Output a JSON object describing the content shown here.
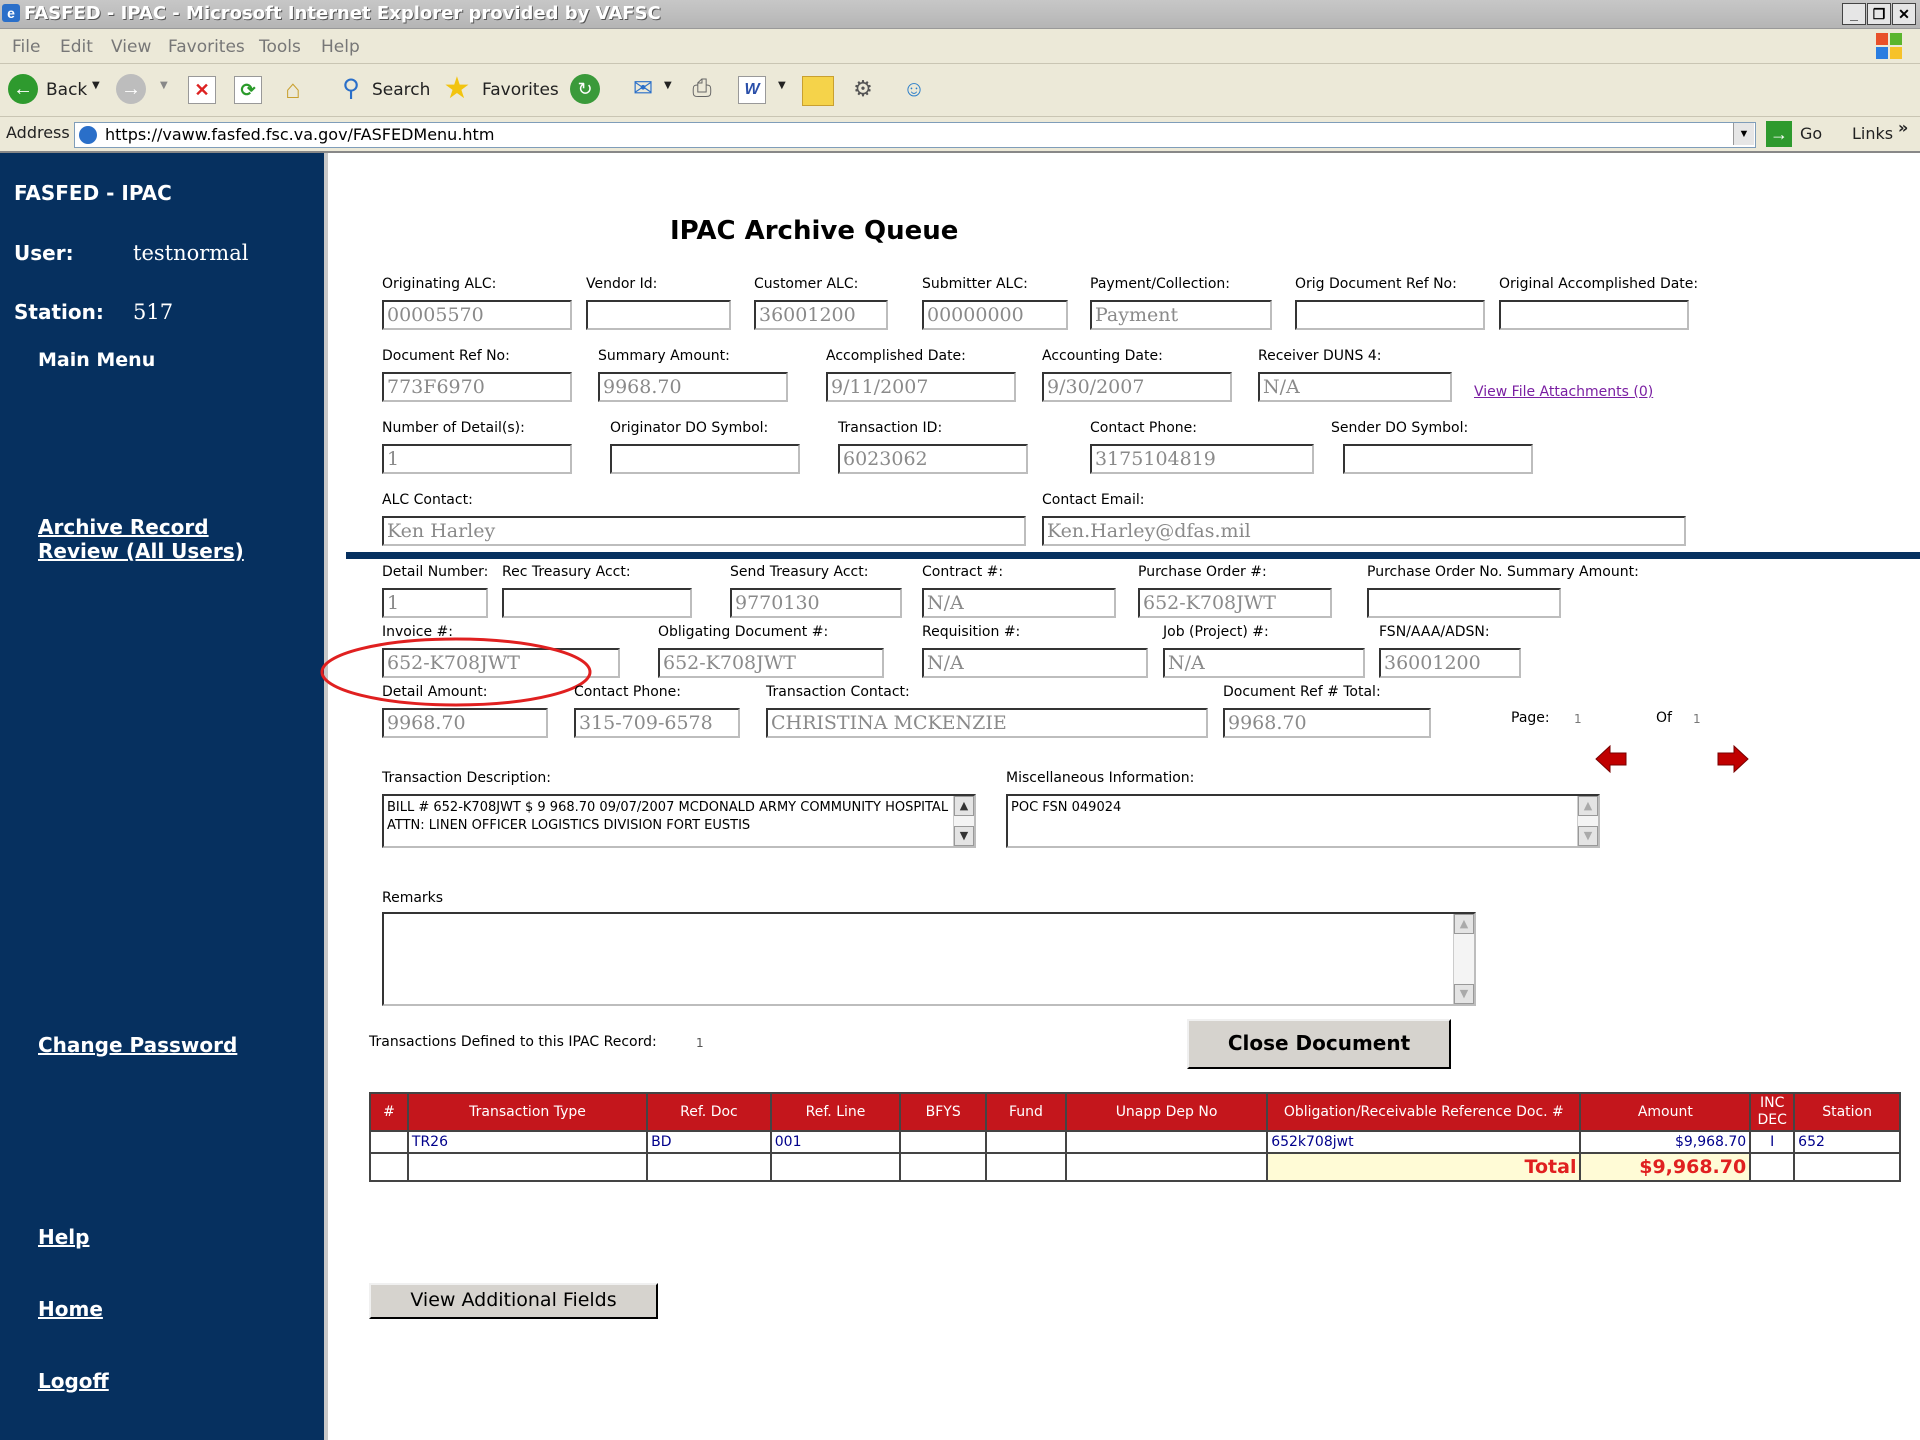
{
  "window": {
    "title": "FASFED - IPAC - Microsoft Internet Explorer provided by VAFSC",
    "ie_glyph": "e"
  },
  "menu": [
    "File",
    "Edit",
    "View",
    "Favorites",
    "Tools",
    "Help"
  ],
  "toolbar": {
    "back": "Back",
    "search": "Search",
    "favorites": "Favorites"
  },
  "address": {
    "label": "Address",
    "url": "https://vaww.fasfed.fsc.va.gov/FASFEDMenu.htm",
    "go": "Go",
    "links": "Links"
  },
  "sidebar": {
    "app_title": "FASFED - IPAC",
    "user_label": "User:",
    "user_value": "testnormal",
    "station_label": "Station:",
    "station_value": "517",
    "main_menu": "Main Menu",
    "archive_link_1": "Archive Record",
    "archive_link_2": "Review (All Users)",
    "change_password": "Change Password",
    "help": "Help",
    "home": "Home",
    "logoff": "Logoff"
  },
  "page": {
    "title": "IPAC Archive Queue",
    "fields": {
      "orig_alc": {
        "label": "Originating ALC:",
        "value": "00005570"
      },
      "vendor_id": {
        "label": "Vendor Id:",
        "value": ""
      },
      "customer_alc": {
        "label": "Customer ALC:",
        "value": "36001200"
      },
      "submitter_alc": {
        "label": "Submitter ALC:",
        "value": "00000000"
      },
      "payment_collection": {
        "label": "Payment/Collection:",
        "value": "Payment"
      },
      "orig_doc_ref": {
        "label": "Orig Document Ref No:",
        "value": ""
      },
      "orig_accomplished_date": {
        "label": "Original Accomplished Date:",
        "value": ""
      },
      "doc_ref_no": {
        "label": "Document Ref No:",
        "value": "773F6970"
      },
      "summary_amount": {
        "label": "Summary Amount:",
        "value": "9968.70"
      },
      "accomplished_date": {
        "label": "Accomplished Date:",
        "value": "9/11/2007"
      },
      "accounting_date": {
        "label": "Accounting Date:",
        "value": "9/30/2007"
      },
      "receiver_duns": {
        "label": "Receiver DUNS 4:",
        "value": "N/A"
      },
      "num_details": {
        "label": "Number of Detail(s):",
        "value": "1"
      },
      "originator_do": {
        "label": "Originator DO Symbol:",
        "value": ""
      },
      "transaction_id": {
        "label": "Transaction ID:",
        "value": "6023062"
      },
      "contact_phone": {
        "label": "Contact Phone:",
        "value": "3175104819"
      },
      "sender_do": {
        "label": "Sender DO Symbol:",
        "value": ""
      },
      "alc_contact": {
        "label": "ALC Contact:",
        "value": "Ken  Harley"
      },
      "contact_email": {
        "label": "Contact Email:",
        "value": "Ken.Harley@dfas.mil"
      },
      "detail_number": {
        "label": "Detail Number:",
        "value": "1"
      },
      "rec_treasury": {
        "label": "Rec Treasury Acct:",
        "value": ""
      },
      "send_treasury": {
        "label": "Send Treasury Acct:",
        "value": "9770130"
      },
      "contract": {
        "label": "Contract #:",
        "value": "N/A"
      },
      "purchase_order": {
        "label": "Purchase Order #:",
        "value": "652-K708JWT"
      },
      "po_summary_amount": {
        "label": "Purchase Order No. Summary Amount:",
        "value": ""
      },
      "invoice": {
        "label": "Invoice #:",
        "value": "652-K708JWT"
      },
      "obligating_doc": {
        "label": "Obligating Document #:",
        "value": "652-K708JWT"
      },
      "requisition": {
        "label": "Requisition #:",
        "value": "N/A"
      },
      "job_project": {
        "label": "Job (Project) #:",
        "value": "N/A"
      },
      "fsn": {
        "label": "FSN/AAA/ADSN:",
        "value": "36001200"
      },
      "detail_amount": {
        "label": "Detail Amount:",
        "value": "9968.70"
      },
      "detail_contact_phone": {
        "label": "Contact Phone:",
        "value": "315-709-6578"
      },
      "transaction_contact": {
        "label": "Transaction Contact:",
        "value": "CHRISTINA MCKENZIE"
      },
      "doc_ref_total": {
        "label": "Document Ref # Total:",
        "value": "9968.70"
      }
    },
    "view_attachments": "View File Attachments (0)",
    "pager": {
      "page_label": "Page:",
      "page": "1",
      "of_label": "Of",
      "of": "1"
    },
    "transaction_description": {
      "label": "Transaction Description:",
      "value": "BILL # 652-K708JWT  $ 9 968.70  09/07/2007  MCDONALD ARMY COMMUNITY HOSPITAL ATTN: LINEN OFFICER LOGISTICS DIVISION FORT EUSTIS"
    },
    "misc_info": {
      "label": "Miscellaneous Information:",
      "value": "POC FSN 049024"
    },
    "remarks": {
      "label": "Remarks",
      "value": ""
    },
    "transactions_defined": {
      "label": "Transactions Defined to this IPAC Record:",
      "value": "1"
    },
    "close_button": "Close Document",
    "view_additional": "View Additional Fields",
    "table": {
      "headers": [
        "#",
        "Transaction Type",
        "Ref. Doc",
        "Ref. Line",
        "BFYS",
        "Fund",
        "Unapp Dep No",
        "Obligation/Receivable Reference Doc. #",
        "Amount",
        "INC DEC",
        "Station"
      ],
      "rows": [
        [
          "",
          "TR26",
          "BD",
          "001",
          "",
          "",
          "",
          "652k708jwt",
          "$9,968.70",
          "I",
          "652"
        ]
      ],
      "total_label": "Total",
      "total_value": "$9,968.70"
    }
  },
  "colors": {
    "sidebar": "#06305f",
    "table_header": "#c4161c",
    "annotation": "#e02020"
  }
}
